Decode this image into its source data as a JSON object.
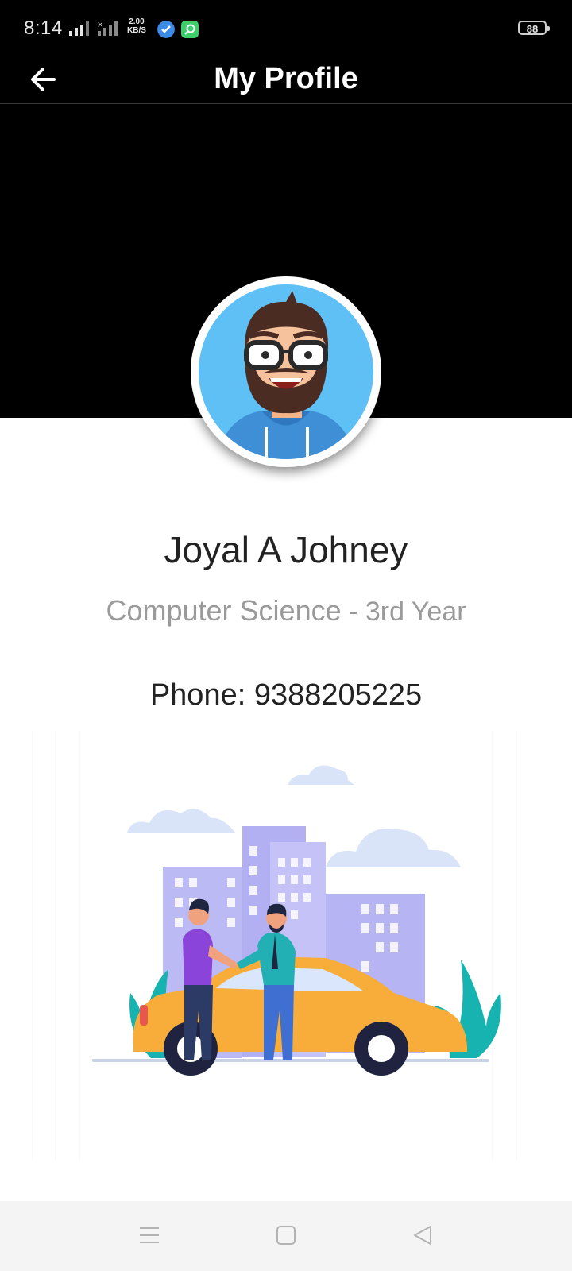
{
  "status_bar": {
    "time": "8:14",
    "network_speed_value": "2.00",
    "network_speed_unit": "KB/S",
    "battery_level": "88"
  },
  "app_bar": {
    "title": "My Profile",
    "back_icon": "arrow-left-icon"
  },
  "profile": {
    "name": "Joyal A Johney",
    "department": "Computer Science",
    "separator": " - ",
    "year": "3rd Year",
    "phone": "Phone: 9388205225"
  },
  "illustration": {
    "icon": "ride-share-handshake-illustration"
  },
  "nav_bar": {
    "menu_icon": "menu-icon",
    "home_icon": "square-icon",
    "back_icon": "triangle-back-icon"
  },
  "colors": {
    "header_bg": "#000000",
    "avatar_bg": "#5fc0f5",
    "car_color": "#f8ad3a",
    "building_color": "#b6b4f3"
  }
}
